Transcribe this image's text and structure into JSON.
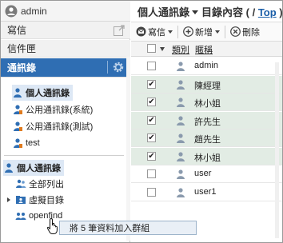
{
  "user": {
    "name": "admin",
    "icon": "user-avatar-icon"
  },
  "nav": {
    "compose": "寫信",
    "mailbox": "信件匣",
    "addressbook": "通訊錄"
  },
  "address_books": [
    {
      "label": "個人通訊錄",
      "selected": true,
      "icon": "person-book-icon"
    },
    {
      "label": "公用通訊錄(系統)",
      "selected": false,
      "icon": "public-book-icon"
    },
    {
      "label": "公用通訊錄(測試)",
      "selected": false,
      "icon": "public-book-icon"
    },
    {
      "label": "test",
      "selected": false,
      "icon": "public-book-icon"
    }
  ],
  "tree": {
    "root": "個人通訊錄",
    "items": [
      {
        "label": "全部列出",
        "icon": "people-icon",
        "arrow": false
      },
      {
        "label": "虛擬目錄",
        "icon": "folder-people-icon",
        "arrow": true
      },
      {
        "label": "openfind",
        "icon": "group-icon",
        "arrow": false
      }
    ]
  },
  "header": {
    "title": "個人通訊錄",
    "separator": "目錄內容",
    "path_open": "( / ",
    "path_link": "Top",
    "path_close": " )"
  },
  "toolbar": {
    "compose": "寫信",
    "add": "新增",
    "delete": "刪除"
  },
  "grid": {
    "col_type": "類別",
    "col_nickname": "暱稱",
    "rows": [
      {
        "name": "admin",
        "checked": false
      },
      {
        "name": "陳經理",
        "checked": true
      },
      {
        "name": "林小姐",
        "checked": true
      },
      {
        "name": "許先生",
        "checked": true
      },
      {
        "name": "趙先生",
        "checked": true
      },
      {
        "name": "林小姐",
        "checked": true
      },
      {
        "name": "user",
        "checked": false
      },
      {
        "name": "user1",
        "checked": false
      }
    ]
  },
  "drag_tooltip": "將 5 筆資料加入群組",
  "colors": {
    "accent": "#2f6eb3",
    "selected_row": "#e2ece4",
    "link": "#1a5ea8"
  }
}
